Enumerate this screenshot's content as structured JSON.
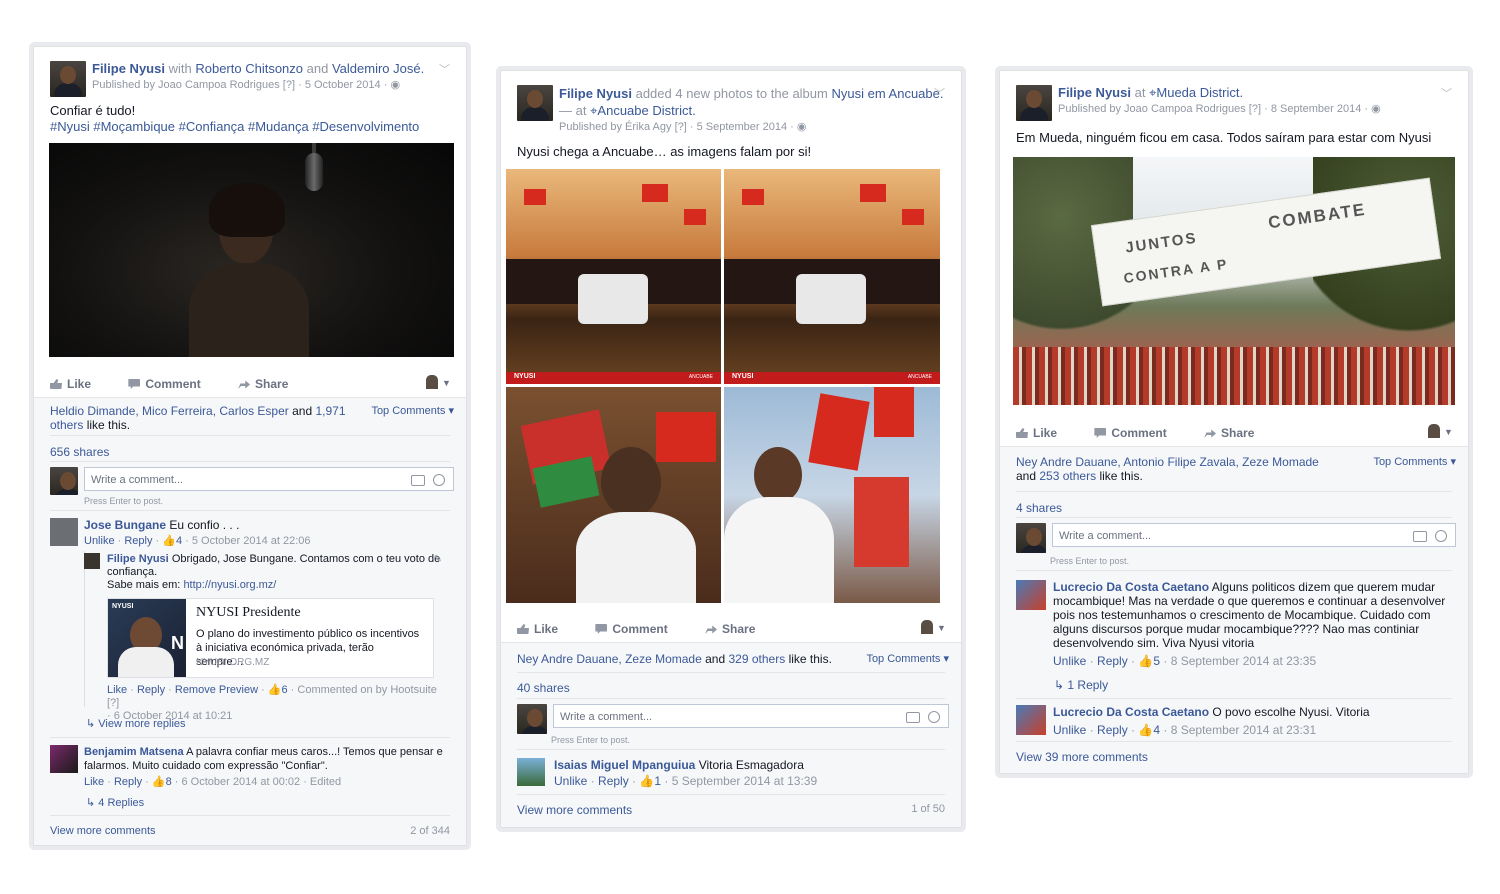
{
  "post1": {
    "author": "Filipe Nyusi",
    "with_word": "with",
    "tagged1": "Roberto Chitsonzo",
    "and_word": "and",
    "tagged2": "Valdemiro José.",
    "published_by": "Published by Joao Campoa Rodrigues",
    "published_q": "[?]",
    "date": "5 October 2014",
    "message": "Confiar é tudo!",
    "hashtags": "#Nyusi #Moçambique #Confiança #Mudança #Desenvolvimento",
    "actions": {
      "like": "Like",
      "comment": "Comment",
      "share": "Share"
    },
    "likers": "Heldio Dimande, Mico Ferreira, Carlos Esper",
    "likers_and": "and",
    "likers_others": "1,971 others",
    "likers_suffix": "like this.",
    "top_comments": "Top Comments",
    "shares": "656 shares",
    "write_placeholder": "Write a comment...",
    "press_enter": "Press Enter to post.",
    "comment1": {
      "name": "Jose Bungane",
      "text": "Eu confio . . .",
      "unlike": "Unlike",
      "reply": "Reply",
      "likes": "4",
      "time": "5 October 2014 at 22:06"
    },
    "reply1": {
      "name": "Filipe Nyusi",
      "text": "Obrigado, Jose Bungane. Contamos com o teu voto de confiança.",
      "text2": "Sabe mais em:",
      "url": "http://nyusi.org.mz/",
      "preview_title": "NYUSI Presidente",
      "preview_desc": "O plano do investimento público os incentivos à iniciativa económica privada, terão sempre…",
      "preview_domain": "NYUSI.ORG.MZ",
      "thumb_brand": "NYUSI",
      "thumb_letter": "N",
      "like": "Like",
      "reply": "Reply",
      "remove_preview": "Remove Preview",
      "likes": "6",
      "commented_on": "Commented on by Hootsuite",
      "commented_q": "[?]",
      "time": "6 October 2014 at 10:21"
    },
    "view_more_replies": "View more replies",
    "comment2": {
      "name": "Benjamim Matsena",
      "text": "A palavra confiar meus caros...! Temos que pensar e falarmos. Muito cuidado com expressão \"Confiar\".",
      "like": "Like",
      "reply": "Reply",
      "likes": "8",
      "time": "6 October 2014 at 00:02",
      "edited": "Edited"
    },
    "replies_link": "4 Replies",
    "view_more_comments": "View more comments",
    "pager": "2 of 344"
  },
  "post2": {
    "author": "Filipe Nyusi",
    "added": "added 4 new photos to the album",
    "album": "Nyusi em Ancuabe.",
    "at": "— at",
    "place": "Ancuabe District.",
    "published_by": "Published by Érika Agy",
    "published_q": "[?]",
    "date": "5 September 2014",
    "message": "Nyusi chega a Ancuabe… as imagens falam por si!",
    "photo_brand": "NYUSI",
    "photo_place": "ANCUABE",
    "actions": {
      "like": "Like",
      "comment": "Comment",
      "share": "Share"
    },
    "likers": "Ney Andre Dauane, Zeze Momade",
    "likers_and": "and",
    "likers_others": "329 others",
    "likers_suffix": "like this.",
    "top_comments": "Top Comments",
    "shares": "40 shares",
    "write_placeholder": "Write a comment...",
    "press_enter": "Press Enter to post.",
    "comment1": {
      "name": "Isaias Miguel Mpanguiua",
      "text": "Vitoria Esmagadora",
      "unlike": "Unlike",
      "reply": "Reply",
      "likes": "1",
      "time": "5 September 2014 at 13:39"
    },
    "view_more_comments": "View more comments",
    "pager": "1 of 50"
  },
  "post3": {
    "author": "Filipe Nyusi",
    "at": "at",
    "place": "Mueda District.",
    "published_by": "Published by Joao Campoa Rodrigues",
    "published_q": "[?]",
    "date": "8 September 2014",
    "message": "Em Mueda, ninguém ficou em casa. Todos saíram para estar com Nyusi",
    "banner1": "JUNTOS",
    "banner2": "COMBATE",
    "banner3": "CONTRA A P",
    "actions": {
      "like": "Like",
      "comment": "Comment",
      "share": "Share"
    },
    "likers": "Ney Andre Dauane, Antonio Filipe Zavala, Zeze Momade",
    "likers_and": "and",
    "likers_others": "253 others",
    "likers_suffix": "like this.",
    "top_comments": "Top Comments",
    "shares": "4 shares",
    "write_placeholder": "Write a comment...",
    "press_enter": "Press Enter to post.",
    "comment1": {
      "name": "Lucrecio Da Costa Caetano",
      "text": "Alguns politicos dizem que querem mudar mocambique! Mas na verdade o que queremos e continuar a desenvolver pois nos testemunhamos o crescimento de Mocambique. Cuidado com alguns discursos porque mudar mocambique???? Nao mas continiar desenvolvendo sim. Viva Nyusi vitoria",
      "unlike": "Unlike",
      "reply": "Reply",
      "likes": "5",
      "time": "8 September 2014 at 23:35"
    },
    "reply_link": "1 Reply",
    "comment2": {
      "name": "Lucrecio Da Costa Caetano",
      "text": "O povo escolhe Nyusi. Vitoria",
      "unlike": "Unlike",
      "reply": "Reply",
      "likes": "4",
      "time": "8 September 2014 at 23:31"
    },
    "view_more_comments": "View 39 more comments"
  },
  "colors": {
    "link": "#3b5998",
    "muted": "#9197a3",
    "ufi_bg": "#f6f7f9"
  },
  "icons": [
    "like-icon",
    "comment-icon",
    "share-icon",
    "camera-icon",
    "smiley-icon",
    "location-pin-icon",
    "globe-icon",
    "reply-arrow-icon",
    "chevron-down-icon"
  ]
}
